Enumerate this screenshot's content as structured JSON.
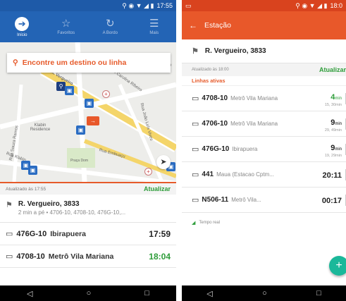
{
  "left": {
    "status": {
      "time": "17:55"
    },
    "tabs": [
      {
        "label": "Início",
        "icon": "arrow-circle-icon",
        "active": true
      },
      {
        "label": "Favoritos",
        "icon": "star-icon",
        "active": false
      },
      {
        "label": "A Bordo",
        "icon": "history-icon",
        "active": false
      },
      {
        "label": "Mais",
        "icon": "menu-icon",
        "active": false
      }
    ],
    "search": {
      "placeholder": "Encontre um destino ou linha"
    },
    "map": {
      "labels": [
        "Rua Carolina Ribeiro",
        "Rua João Luís Vives",
        "Rua Souza Ramos",
        "Klabin Residence",
        "Rua Embuaçu",
        "Rua Klabin",
        "Rua Fábio Pr",
        "R. Vergueiro",
        "Praça Dom"
      ]
    },
    "update": {
      "text": "Atualizado às 17:55",
      "button": "Atualizar"
    },
    "stop": {
      "title": "R. Vergueiro, 3833",
      "subtitle": "2 min a pé • 4706-10, 4708-10, 476G-10,..."
    },
    "lines": [
      {
        "code": "476G-10",
        "dest": "Ibirapuera",
        "time": "17:59",
        "realtime": false
      },
      {
        "code": "4708-10",
        "dest": "Metrô Vila Mariana",
        "time": "18:04",
        "realtime": true
      }
    ]
  },
  "right": {
    "status": {
      "time": "18:0"
    },
    "header": {
      "title": "Estação"
    },
    "stop": {
      "title": "R. Vergueiro, 3833"
    },
    "update": {
      "text": "Atualizado às 18:00",
      "button": "Atualizar"
    },
    "section": "Linhas ativas",
    "lines": [
      {
        "code": "4708-10",
        "dest": "Metrô Vila Mariana",
        "big": "4",
        "unit": "min",
        "sub": "15, 30min",
        "realtime": true
      },
      {
        "code": "4706-10",
        "dest": "Metrô Vila Mariana",
        "big": "9",
        "unit": "min",
        "sub": "29, 49min",
        "realtime": false
      },
      {
        "code": "476G-10",
        "dest": "Ibirapuera",
        "big": "9",
        "unit": "min",
        "sub": "19, 29min",
        "realtime": false
      },
      {
        "code": "441",
        "dest": "Maua (Estacao Cptm...",
        "big": "20:11",
        "unit": "",
        "sub": "",
        "realtime": false
      },
      {
        "code": "N506-11",
        "dest": "Metrô Vila...",
        "big": "00:17",
        "unit": "",
        "sub": "",
        "realtime": false
      }
    ],
    "legend": "Tempo real"
  },
  "colors": {
    "blue": "#2364b5",
    "orange": "#e8582a",
    "green": "#2e9d3a",
    "teal": "#1bb89a"
  }
}
